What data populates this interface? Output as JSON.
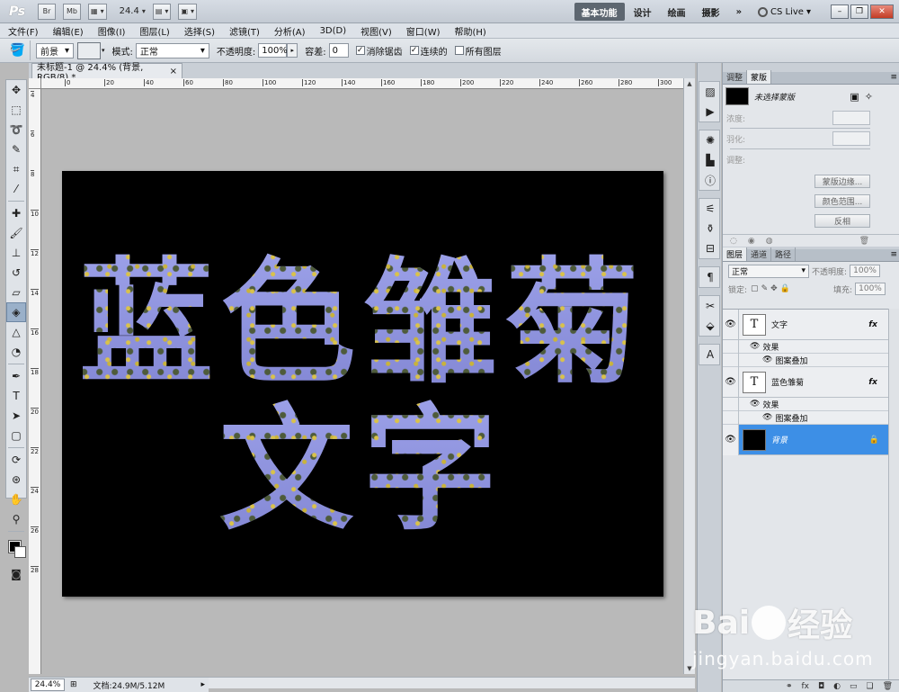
{
  "app": {
    "logo": "Ps",
    "zoom": "24.4",
    "btn_br": "Br",
    "btn_mb": "Mb",
    "workspaces": {
      "active": "基本功能",
      "items": [
        "设计",
        "绘画",
        "摄影"
      ],
      "more": "»"
    },
    "cs_live": "CS Live"
  },
  "menu": [
    "文件(F)",
    "编辑(E)",
    "图像(I)",
    "图层(L)",
    "选择(S)",
    "滤镜(T)",
    "分析(A)",
    "3D(D)",
    "视图(V)",
    "窗口(W)",
    "帮助(H)"
  ],
  "options": {
    "fill_source": "前景",
    "mode_label": "模式:",
    "mode_value": "正常",
    "opacity_label": "不透明度:",
    "opacity_value": "100%",
    "tolerance_label": "容差:",
    "tolerance_value": "0",
    "antialias_label": "消除锯齿",
    "antialias_checked": "✓",
    "contiguous_label": "连续的",
    "contiguous_checked": "✓",
    "all_layers_label": "所有图层"
  },
  "document": {
    "tab_title": "未标题-1 @ 24.4% (背景, RGB/8) *",
    "tab_close": "×",
    "art_line1": "蓝色雏菊",
    "art_line2": "文字",
    "ruler_top": [
      "0",
      "20",
      "40",
      "60",
      "80",
      "100",
      "120",
      "140",
      "160",
      "180",
      "200",
      "220",
      "240",
      "260",
      "280",
      "300"
    ],
    "ruler_left": [
      "4",
      "6",
      "8",
      "10",
      "12",
      "14",
      "16",
      "18",
      "20",
      "22",
      "24",
      "26",
      "28"
    ]
  },
  "status": {
    "zoom": "24.4%",
    "doc_info": "文档:24.9M/5.12M"
  },
  "mask_panel": {
    "tabs": [
      "调整",
      "蒙版"
    ],
    "active_tab": "蒙版",
    "title": "未选择蒙版",
    "density_label": "浓度:",
    "feather_label": "羽化:",
    "refine_label": "调整:",
    "btn_edge": "蒙版边缘...",
    "btn_range": "颜色范围...",
    "btn_invert": "反相"
  },
  "layers_panel": {
    "tabs": [
      "图层",
      "通道",
      "路径"
    ],
    "active_tab": "图层",
    "blend_mode": "正常",
    "opacity_label": "不透明度:",
    "opacity_value": "100%",
    "lock_label": "锁定:",
    "fill_label": "填充:",
    "fill_value": "100%",
    "layers": [
      {
        "name": "文字",
        "thumb": "T",
        "fx": "fx",
        "effects_label": "效果",
        "effect": "图案叠加"
      },
      {
        "name": "蓝色雏菊",
        "thumb": "T",
        "fx": "fx",
        "effects_label": "效果",
        "effect": "图案叠加"
      },
      {
        "name": "背景",
        "lock": "🔒"
      }
    ]
  },
  "watermark": {
    "main_left": "Bai",
    "main_right": "经验",
    "paw_letter": "du",
    "sub": "jingyan.baidu.com"
  }
}
